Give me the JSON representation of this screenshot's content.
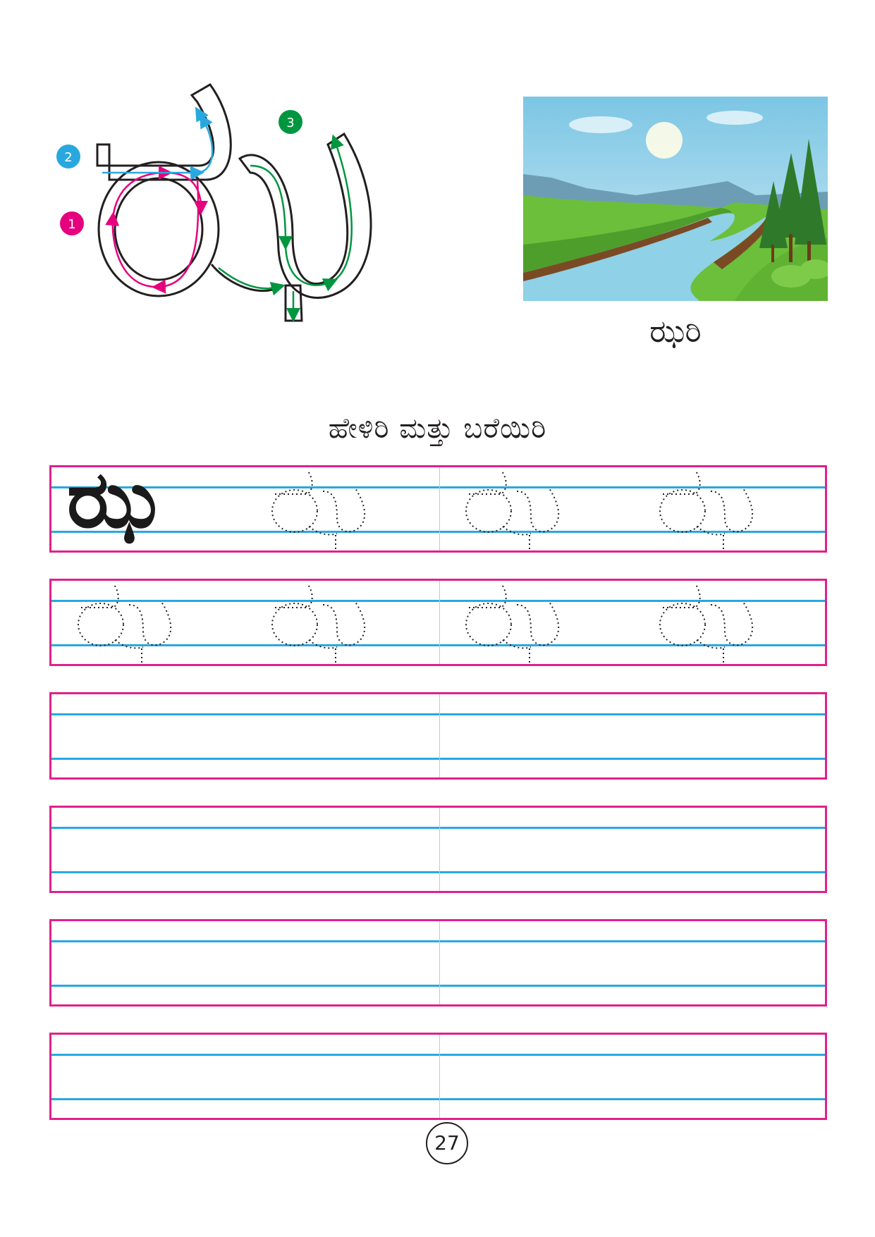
{
  "letter": {
    "char": "ಝ",
    "stroke_steps": [
      {
        "number": "1",
        "color": "#e6007e"
      },
      {
        "number": "2",
        "color": "#29a8e0"
      },
      {
        "number": "3",
        "color": "#00963f"
      }
    ]
  },
  "picture": {
    "label": "ಝರಿ"
  },
  "heading": "ಹೇಳಿರಿ ಮತ್ತು ಬರೆಯಿರಿ",
  "practice": {
    "model_char": "ಝ",
    "trace_row_1_count": 3,
    "trace_row_2_count": 4,
    "empty_rows": 4
  },
  "page_number": "27",
  "colors": {
    "border": "#e0218a",
    "guide": "#29a8e0"
  }
}
